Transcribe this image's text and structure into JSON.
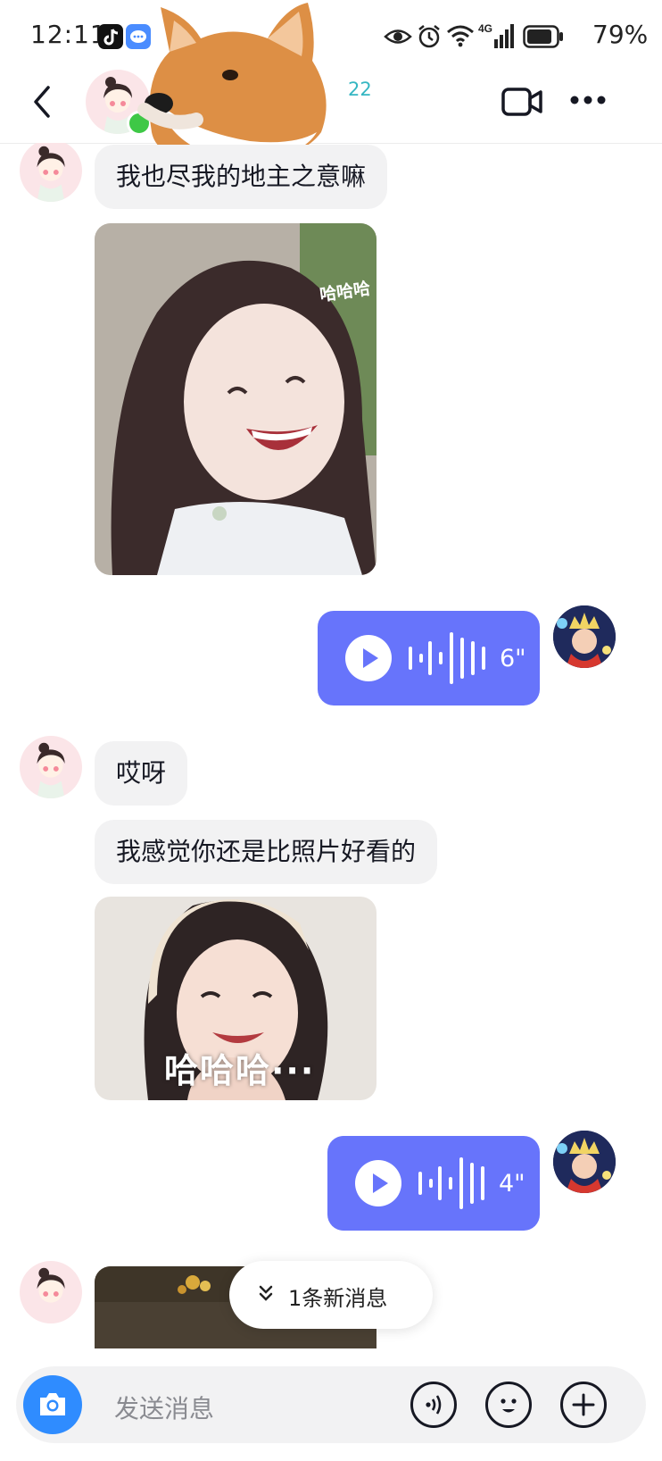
{
  "status_bar": {
    "time": "12:11",
    "battery_percent": "79%",
    "icons": [
      "tiktok-icon",
      "message-app-icon",
      "eye-icon",
      "alarm-icon",
      "wifi-icon",
      "4g-signal-icon",
      "battery-icon"
    ]
  },
  "header": {
    "count": "22",
    "online": true,
    "icons": [
      "back-arrow-icon",
      "video-call-icon",
      "more-icon"
    ]
  },
  "messages": [
    {
      "side": "in",
      "type": "text",
      "text": "我也尽我的地主之意嘛"
    },
    {
      "side": "in",
      "type": "image",
      "overlay_text": "哈哈哈"
    },
    {
      "side": "out",
      "type": "voice",
      "duration": "6\""
    },
    {
      "side": "in",
      "type": "text",
      "text": "哎呀"
    },
    {
      "side": "in",
      "type": "text",
      "text": "我感觉你还是比照片好看的"
    },
    {
      "side": "in",
      "type": "image",
      "overlay_text": "哈哈哈···"
    },
    {
      "side": "out",
      "type": "voice",
      "duration": "4\""
    },
    {
      "side": "in",
      "type": "image"
    }
  ],
  "new_message_pill": {
    "label": "1条新消息"
  },
  "input_bar": {
    "placeholder": "发送消息",
    "icons": [
      "camera-icon",
      "voice-input-icon",
      "emoji-icon",
      "plus-icon"
    ]
  },
  "colors": {
    "voice_bubble": "#6774fb",
    "incoming_bubble": "#f2f2f3",
    "online": "#3ec846",
    "camera": "#2f8cff"
  }
}
